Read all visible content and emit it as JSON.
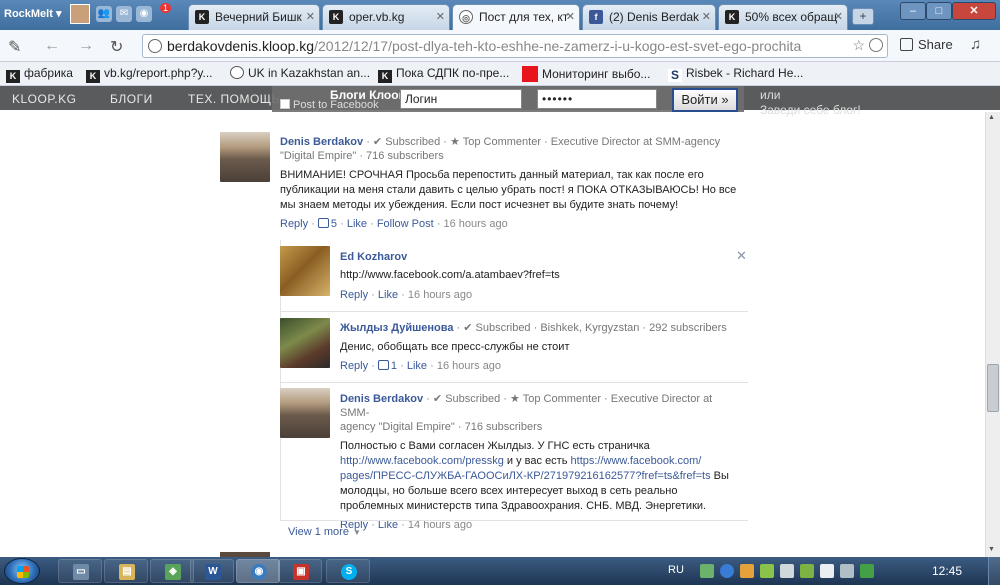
{
  "browser": {
    "rockmelt_label": "RockMelt ▾",
    "notification_count": "1",
    "tabs": [
      {
        "label": "Вечерний Бишк",
        "icon": "kloop-icon"
      },
      {
        "label": "oper.vb.kg",
        "icon": "kloop-icon"
      },
      {
        "label": "Пост для тех, кт",
        "icon": "globe-icon"
      },
      {
        "label": "(2) Denis Berdak",
        "icon": "facebook-icon"
      },
      {
        "label": "50% всех обращ",
        "icon": "kloop-icon"
      }
    ],
    "url_host": "berdakovdenis.kloop.kg",
    "url_path": "/2012/12/17/post-dlya-teh-kto-eshhe-ne-zamerz-i-u-kogo-est-svet-ego-prochita",
    "share_label": "Share",
    "bookmarks": [
      {
        "label": "фабрика",
        "icon": "kloop-icon"
      },
      {
        "label": "vb.kg/report.php?y...",
        "icon": "kloop-icon"
      },
      {
        "label": "UK in Kazakhstan an...",
        "icon": "globe-icon"
      },
      {
        "label": "Пока СДПК по-пре...",
        "icon": "kloop-icon"
      },
      {
        "label": "Мониторинг выбо...",
        "icon": "red-square-icon"
      },
      {
        "label": "Risbek - Richard He...",
        "icon": "s-icon"
      }
    ]
  },
  "site": {
    "nav": [
      "KLOOP.KG",
      "БЛОГИ",
      "ТЕХ. ПОМОЩЬ"
    ],
    "blogs_title": "Блоги Клоопа",
    "post_to_facebook": "Post to Facebook",
    "login_value": "Логин",
    "password_value": "••••••",
    "login_button": "Войти »",
    "or_text": "или",
    "register_text": "Заведи себе блог!"
  },
  "comments": {
    "top": {
      "name": "Denis Berdakov",
      "meta1": " · ✔ Subscribed · ★ Top Commenter · Executive Director at SMM-agency",
      "meta2": "\"Digital Empire\" · 716 subscribers",
      "text": "ВНИМАНИЕ! СРОЧНАЯ Просьба перепостить данный материал, так как после его публикации на меня стали давить с целью убрать пост! я ПОКА ОТКАЗЫВАЮСЬ! Но все мы знаем методы их убеждения. Если пост исчезнет вы будите знать почему!",
      "reply": "Reply",
      "likes": "5",
      "like": "Like",
      "follow": "Follow Post",
      "time": "16 hours ago"
    },
    "replies": [
      {
        "name": "Ed Kozharov",
        "meta": "",
        "text": "http://www.facebook.com/a.atambaev?fref=ts",
        "reply": "Reply",
        "like": "Like",
        "likes": "",
        "time": "16 hours ago"
      },
      {
        "name": "Жылдыз Дуйшенова",
        "meta": " · ✔ Subscribed · Bishkek, Kyrgyzstan · 292 subscribers",
        "text": "Денис, обобщать все пресс-службы не стоит",
        "reply": "Reply",
        "like": "Like",
        "likes": "1",
        "time": "16 hours ago"
      },
      {
        "name": "Denis Berdakov",
        "meta1": " · ✔ Subscribed · ★ Top Commenter · Executive Director at SMM-",
        "meta2": "agency \"Digital Empire\" · 716 subscribers",
        "text_line1": "Полностью с Вами согласен Жылдыз. У ГНС есть страничка",
        "link1": "http://www.facebook.com/presskg",
        "text_mid": " и у вас есть ",
        "link2a": "https://www.facebook.com/",
        "link2b": "pages/ПРЕСС-СЛУЖБА-ГАООСиЛХ-КР/271979216162577?fref=ts&fref=ts",
        "text_end1": " Вы",
        "text_end2": "молодцы, но больше всего всех интересует выход в сеть реально",
        "text_end3": "проблемных министерств типа Здравоохрания. СНБ. МВД. Энергетики.",
        "reply": "Reply",
        "like": "Like",
        "time": "14 hours ago"
      }
    ],
    "view_more": "View 1 more"
  },
  "taskbar": {
    "lang": "RU",
    "clock": "12:45"
  }
}
